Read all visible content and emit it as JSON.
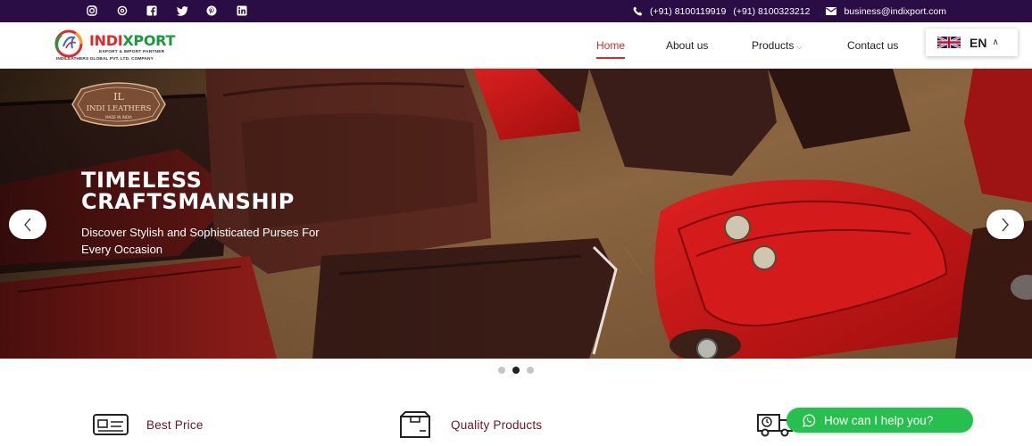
{
  "topbar": {
    "social_icons": [
      "instagram-icon",
      "threads-icon",
      "facebook-icon",
      "twitter-icon",
      "pinterest-icon",
      "linkedin-icon"
    ],
    "phone1": "(+91) 8100119919",
    "phone2": "(+91) 8100323212",
    "email": "business@indixport.com"
  },
  "logo": {
    "word_a": "INDI",
    "word_b": "XPORT",
    "tagline": "EXPORT & IMPORT PARTNER",
    "company": "INDILEATHERS GLOBAL PVT. LTD. COMPANY"
  },
  "nav": {
    "home": "Home",
    "about": "About us",
    "products": "Products",
    "contact": "Contact us"
  },
  "language": {
    "code": "EN"
  },
  "hero": {
    "title_line1": "TIMELESS",
    "title_line2": "CRAFTSMANSHIP",
    "subtitle": "Discover Stylish and Sophisticated Purses For Every Occasion",
    "badge_mono": "IL",
    "badge_name": "INDI LEATHERS",
    "badge_sub": "MADE IN INDIA",
    "active_slide": 2,
    "slide_count": 3
  },
  "features": {
    "best_price": "Best Price",
    "quality": "Quality Products"
  },
  "whatsapp": {
    "label": "How can I help you?"
  },
  "colors": {
    "topbar": "#2b0d45",
    "accent": "#d62b2b",
    "feature_text": "#6b1420",
    "whatsapp": "#27c04f"
  }
}
